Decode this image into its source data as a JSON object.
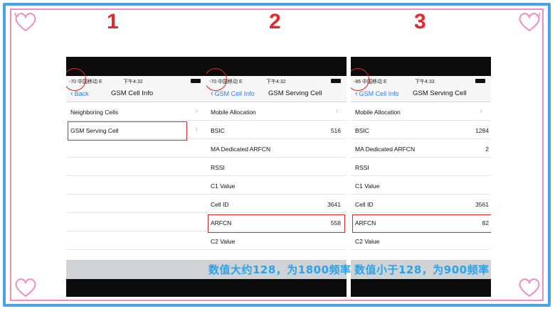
{
  "steps": [
    "1",
    "2",
    "3"
  ],
  "panel1": {
    "status": {
      "signal": "-70 中国移动  E",
      "time": "下午4:32"
    },
    "nav": {
      "back": "Back",
      "title": "GSM Cell Info"
    },
    "rows": [
      {
        "label": "Neighboring Cells",
        "value": ""
      },
      {
        "label": "GSM Serving Cell",
        "value": ""
      }
    ]
  },
  "panel2": {
    "status": {
      "signal": "-70 中国移动  E",
      "time": "下午4:32"
    },
    "nav": {
      "back": "GSM Cell Info",
      "title": "GSM Serving Cell"
    },
    "rows": [
      {
        "label": "Mobile Allocation",
        "value": ""
      },
      {
        "label": "BSIC",
        "value": "516"
      },
      {
        "label": "MA Dedicated ARFCN",
        "value": ""
      },
      {
        "label": "RSSI",
        "value": ""
      },
      {
        "label": "C1 Value",
        "value": ""
      },
      {
        "label": "Cell ID",
        "value": "3641"
      },
      {
        "label": "ARFCN",
        "value": "558"
      },
      {
        "label": "C2 Value",
        "value": ""
      }
    ],
    "caption": "数值大约128，为1800频率"
  },
  "panel3": {
    "status": {
      "signal": "-86 中国移动  E",
      "time": "下午4:33"
    },
    "nav": {
      "back": "GSM Cell Info",
      "title": "GSM Serving Cell"
    },
    "rows": [
      {
        "label": "Mobile Allocation",
        "value": ""
      },
      {
        "label": "BSIC",
        "value": "1284"
      },
      {
        "label": "MA Dedicated ARFCN",
        "value": "2"
      },
      {
        "label": "RSSI",
        "value": ""
      },
      {
        "label": "C1 Value",
        "value": ""
      },
      {
        "label": "Cell ID",
        "value": "3561"
      },
      {
        "label": "ARFCN",
        "value": "82"
      },
      {
        "label": "C2 Value",
        "value": ""
      }
    ],
    "caption": "数值小于128，为900频率"
  },
  "colors": {
    "accent_red": "#e8262b",
    "caption_blue": "#2aa3e8",
    "frame_blue": "#4aa3e8",
    "frame_pink": "#f08bc4"
  }
}
